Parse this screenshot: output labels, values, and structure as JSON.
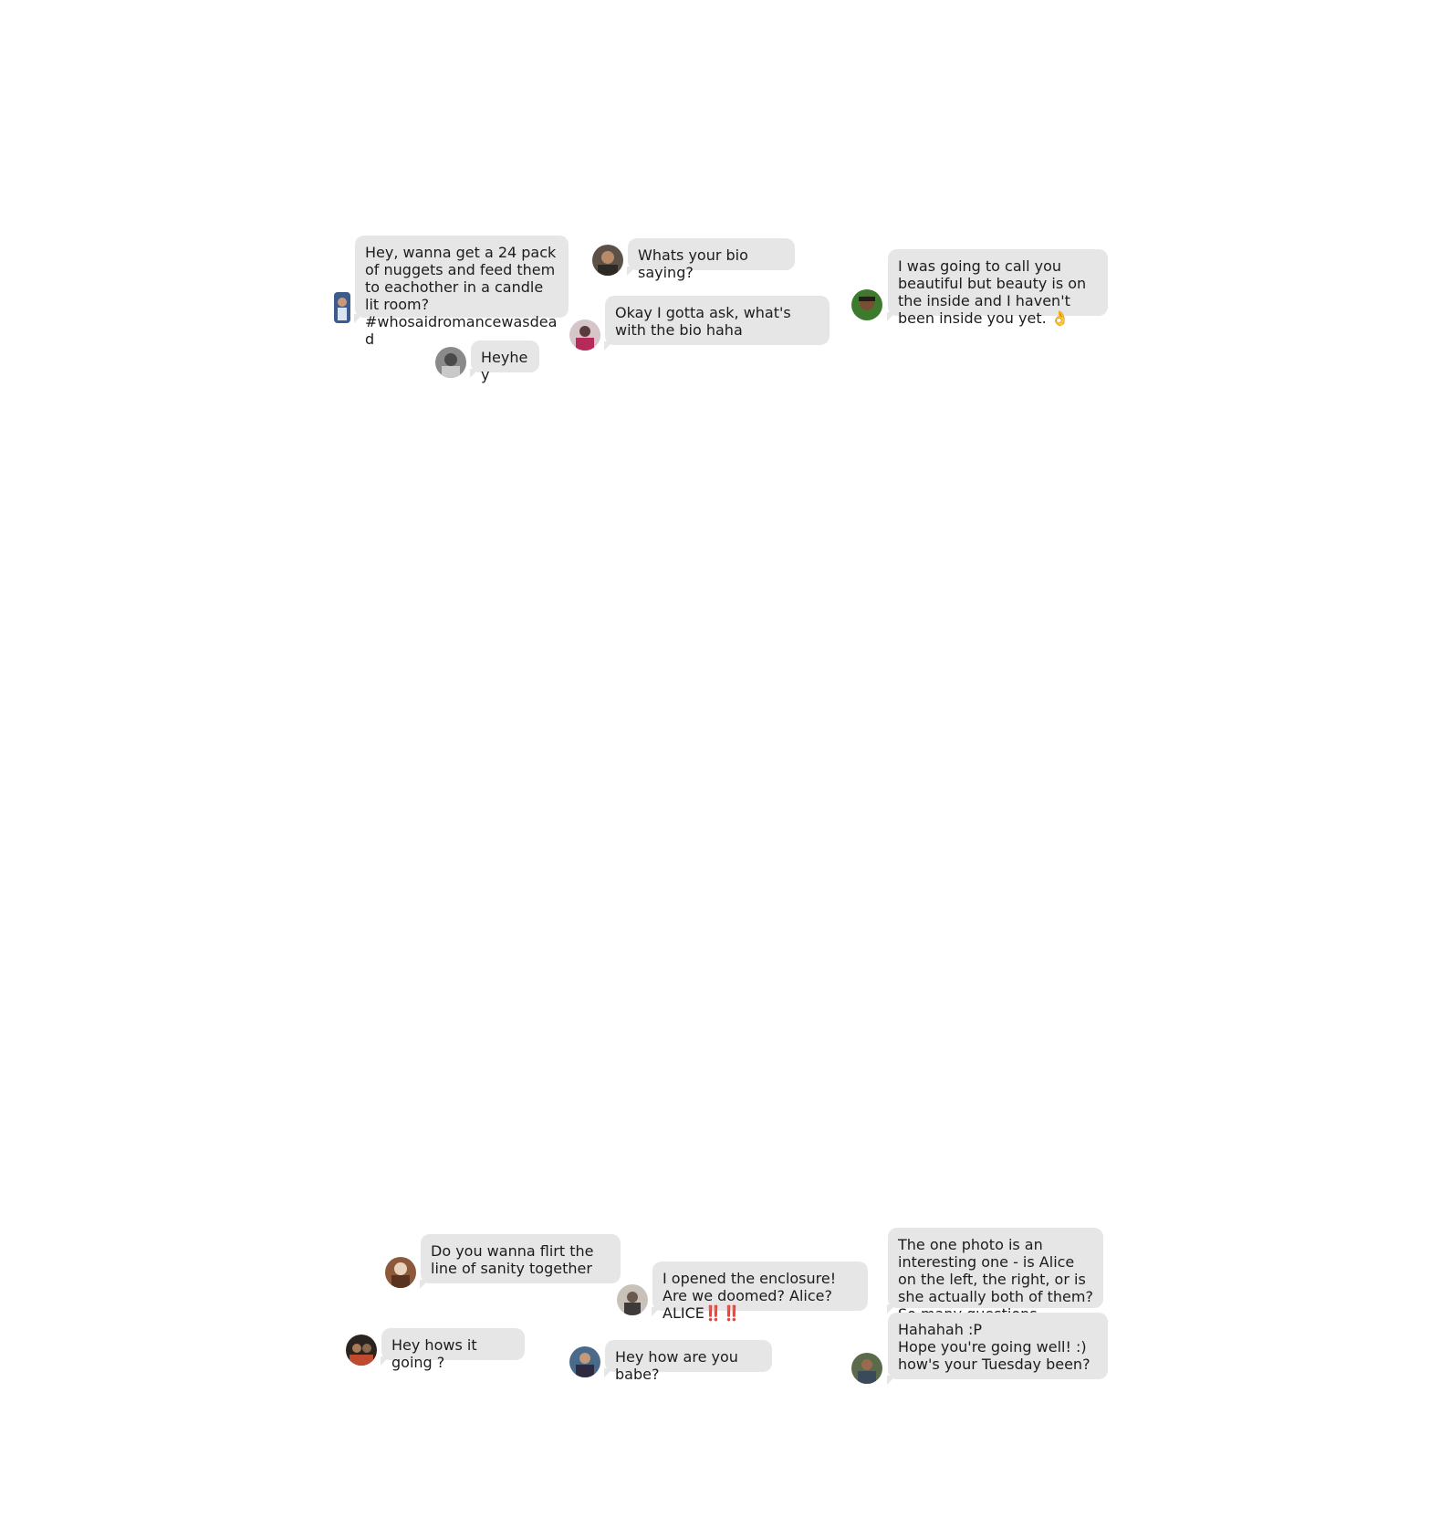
{
  "messages": [
    {
      "id": "m1",
      "text": "Hey, wanna get a 24 pack of nuggets and feed them to eachother in a candle lit room? #whosaidromancewasdead",
      "avatar": "avatar-blue"
    },
    {
      "id": "m2",
      "text": "Whats your bio saying?",
      "avatar": "avatar-brown"
    },
    {
      "id": "m3",
      "text": "I was going to call you beautiful but beauty is on the inside and I haven't been inside you yet. 👌",
      "avatar": "avatar-green"
    },
    {
      "id": "m4",
      "text": "Okay I gotta ask, what's with the bio haha",
      "avatar": "avatar-pink"
    },
    {
      "id": "m5",
      "text": "Heyhey",
      "avatar": "avatar-gray"
    },
    {
      "id": "m6",
      "text": "Do you wanna flirt the line of sanity together",
      "avatar": "avatar-orange"
    },
    {
      "id": "m7",
      "text_main": "I opened the enclosure! Are we doomed? Alice? ALICE",
      "text_emoji": "‼️‼️",
      "avatar": "avatar-tan"
    },
    {
      "id": "m8",
      "text": "The one photo is an interesting one - is Alice on the left, the right, or is she actually both of them? So many questions...",
      "avatar": null
    },
    {
      "id": "m9",
      "text": "Hey hows it going ?",
      "avatar": "avatar-dark"
    },
    {
      "id": "m10",
      "text": "Hey how are you babe?",
      "avatar": "avatar-navy"
    },
    {
      "id": "m11",
      "text": "Hahahah :P\nHope you're going well! :) how's your Tuesday been?",
      "avatar": "avatar-olive"
    }
  ],
  "colors": {
    "bubble": "#e6e6e6",
    "text": "#1c1c1c",
    "emoji_red": "#e2231a"
  }
}
